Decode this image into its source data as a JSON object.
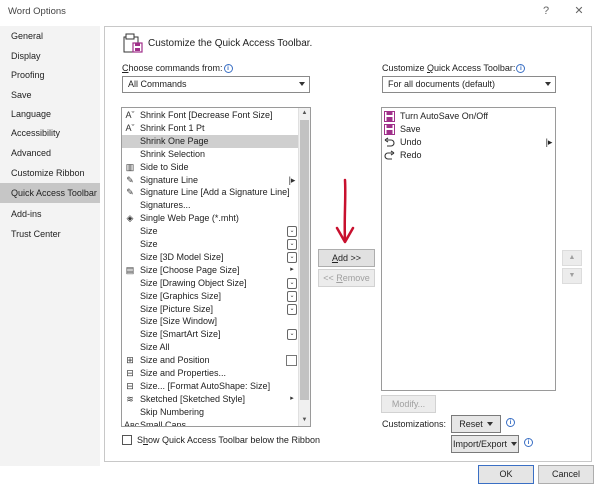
{
  "window": {
    "title": "Word Options",
    "help_glyph": "?",
    "close_glyph": "✕"
  },
  "nav": {
    "items": [
      {
        "label": "General"
      },
      {
        "label": "Display"
      },
      {
        "label": "Proofing"
      },
      {
        "label": "Save"
      },
      {
        "label": "Language"
      },
      {
        "label": "Accessibility"
      },
      {
        "label": "Advanced"
      },
      {
        "label": "Customize Ribbon"
      },
      {
        "label": "Quick Access Toolbar",
        "selected": true
      },
      {
        "label": "Add-ins"
      },
      {
        "label": "Trust Center"
      }
    ]
  },
  "header": {
    "title": "Customize the Quick Access Toolbar."
  },
  "left": {
    "choose_label_u": "C",
    "choose_label_rest": "hoose commands from:",
    "choose_value": "All Commands",
    "commands": [
      {
        "label": "Shrink Font [Decrease Font Size]",
        "icon": "font-shrink-icon",
        "glyph": "Aˇ"
      },
      {
        "label": "Shrink Font 1 Pt",
        "icon": "font-shrink-icon",
        "glyph": "Aˇ"
      },
      {
        "label": "Shrink One Page",
        "icon": "",
        "glyph": "",
        "selected": true
      },
      {
        "label": "Shrink Selection",
        "icon": "",
        "glyph": ""
      },
      {
        "label": "Side to Side",
        "icon": "side-by-side-icon",
        "glyph": "▥"
      },
      {
        "label": "Signature Line",
        "icon": "signature-icon",
        "glyph": "✎",
        "ctl": "bar"
      },
      {
        "label": "Signature Line [Add a Signature Line]",
        "icon": "signature-icon",
        "glyph": "✎"
      },
      {
        "label": "Signatures...",
        "icon": "",
        "glyph": ""
      },
      {
        "label": "Single Web Page (*.mht)",
        "icon": "web-page-icon",
        "glyph": "◈"
      },
      {
        "label": "Size",
        "icon": "",
        "glyph": "",
        "ctl": "dd"
      },
      {
        "label": "Size",
        "icon": "",
        "glyph": "",
        "ctl": "dd"
      },
      {
        "label": "Size [3D Model Size]",
        "icon": "",
        "glyph": "",
        "ctl": "dd"
      },
      {
        "label": "Size [Choose Page Size]",
        "icon": "page-size-icon",
        "glyph": "▤",
        "ctl": "arrow"
      },
      {
        "label": "Size [Drawing Object Size]",
        "icon": "",
        "glyph": "",
        "ctl": "dd"
      },
      {
        "label": "Size [Graphics Size]",
        "icon": "",
        "glyph": "",
        "ctl": "dd"
      },
      {
        "label": "Size [Picture Size]",
        "icon": "",
        "glyph": "",
        "ctl": "dd"
      },
      {
        "label": "Size [Size Window]",
        "icon": "",
        "glyph": ""
      },
      {
        "label": "Size [SmartArt Size]",
        "icon": "",
        "glyph": "",
        "ctl": "dd"
      },
      {
        "label": "Size All",
        "icon": "",
        "glyph": ""
      },
      {
        "label": "Size and Position",
        "icon": "size-position-icon",
        "glyph": "⊞",
        "ctl": "box"
      },
      {
        "label": "Size and Properties...",
        "icon": "size-properties-icon",
        "glyph": "⊟"
      },
      {
        "label": "Size... [Format AutoShape: Size]",
        "icon": "size-properties-icon",
        "glyph": "⊟"
      },
      {
        "label": "Sketched [Sketched Style]",
        "icon": "sketched-icon",
        "glyph": "≋",
        "ctl": "arrow"
      },
      {
        "label": "Skip Numbering",
        "icon": "",
        "glyph": ""
      },
      {
        "label": "Small Caps",
        "icon": "small-caps-icon",
        "glyph": "Aʙᴄ"
      }
    ],
    "scroll_up": "▲",
    "scroll_down": "▼",
    "show_below_u": "h",
    "show_below_pre": "S",
    "show_below_rest": "ow Quick Access Toolbar below the Ribbon"
  },
  "center": {
    "add_u": "A",
    "add_rest": "dd >>",
    "remove_pre": "<< ",
    "remove_u": "R",
    "remove_rest": "emove"
  },
  "right": {
    "customize_label_pre": "Customize ",
    "customize_label_u": "Q",
    "customize_label_rest": "uick Access Toolbar:",
    "customize_value": "For all documents (default)",
    "items": [
      {
        "label": "Turn AutoSave On/Off",
        "icon": "autosave-icon"
      },
      {
        "label": "Save",
        "icon": "save-icon"
      },
      {
        "label": "Undo",
        "icon": "undo-icon",
        "sep": true
      },
      {
        "label": "Redo",
        "icon": "redo-icon"
      }
    ],
    "move_up": "▲",
    "move_down": "▼",
    "modify_label": "Modify...",
    "customizations_label": "Customizations:",
    "reset_label": "Reset",
    "import_export_label": "Import/Export"
  },
  "footer": {
    "ok_label": "OK",
    "cancel_label": "Cancel"
  },
  "colors": {
    "accent": "#3a6fc4",
    "save_icon": "#a0308a",
    "arrow_annotation": "#c8102e"
  }
}
